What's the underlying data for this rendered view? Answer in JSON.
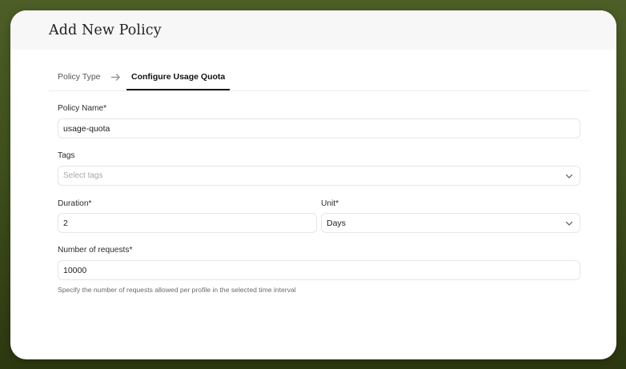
{
  "modal": {
    "title": "Add New Policy"
  },
  "steps": [
    {
      "label": "Policy Type",
      "active": false
    },
    {
      "label": "Configure Usage Quota",
      "active": true
    }
  ],
  "form": {
    "policy_name": {
      "label": "Policy Name*",
      "value": "usage-quota"
    },
    "tags": {
      "label": "Tags",
      "placeholder": "Select tags",
      "value": ""
    },
    "duration": {
      "label": "Duration*",
      "value": "2"
    },
    "unit": {
      "label": "Unit*",
      "value": "Days"
    },
    "requests": {
      "label": "Number of requests*",
      "value": "10000",
      "helper": "Specify the number of requests allowed per profile in the selected time interval"
    }
  },
  "icons": {
    "step_separator": "arrow-right-icon",
    "dropdown": "chevron-down-icon"
  }
}
